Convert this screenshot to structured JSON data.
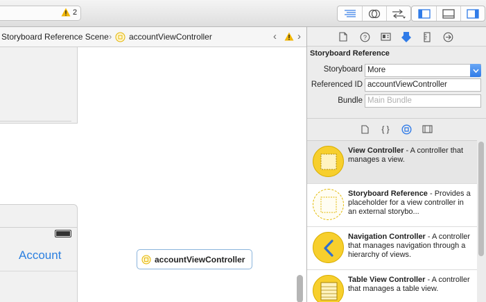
{
  "toolbar": {
    "warning_count": "2",
    "buttons": [
      "standard-editor",
      "assistant-editor",
      "version-editor",
      "navigator-toggle",
      "debug-toggle",
      "utilities-toggle"
    ]
  },
  "jumpbar": {
    "scene": "Storyboard Reference Scene",
    "controller": "accountViewController"
  },
  "canvas": {
    "account_label": "Account",
    "reference_node": "accountViewController"
  },
  "inspector": {
    "section_title": "Storyboard Reference",
    "storyboard_label": "Storyboard",
    "storyboard_value": "More",
    "refid_label": "Referenced ID",
    "refid_value": "accountViewController",
    "bundle_label": "Bundle",
    "bundle_placeholder": "Main Bundle"
  },
  "library": {
    "items": [
      {
        "title": "View Controller",
        "desc": " - A controller that manages a view."
      },
      {
        "title": "Storyboard Reference",
        "desc": " - Provides a placeholder for a view controller in an external storybo..."
      },
      {
        "title": "Navigation Controller",
        "desc": " - A controller that manages navigation through a hierarchy of views."
      },
      {
        "title": "Table View Controller",
        "desc": " - A controller that manages a table view."
      }
    ]
  },
  "colors": {
    "accent": "#2f7be8",
    "icon_yellow": "#f7cf2d",
    "warning": "#f2b705"
  }
}
